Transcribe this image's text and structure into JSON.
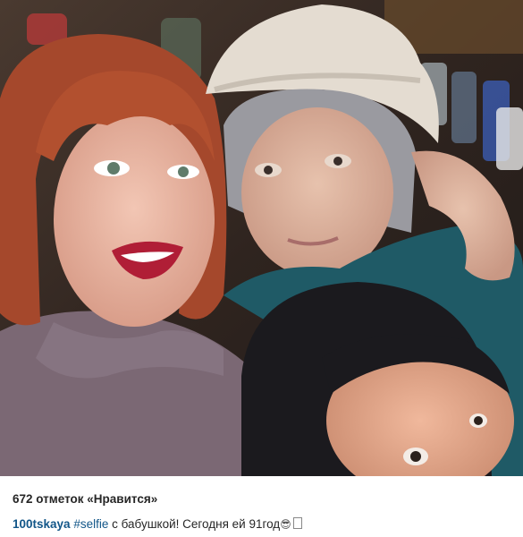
{
  "photo": {
    "subject": "selfie"
  },
  "likes": {
    "text": "672 отметок «Нравится»"
  },
  "caption": {
    "username": "100tskaya",
    "hashtag": "#selfie",
    "text": " с бабушкой! Сегодня ей 91год",
    "emoji_icon": "cool-face-emoji-icon"
  },
  "colors": {
    "link": "#125688",
    "text": "#262626"
  }
}
